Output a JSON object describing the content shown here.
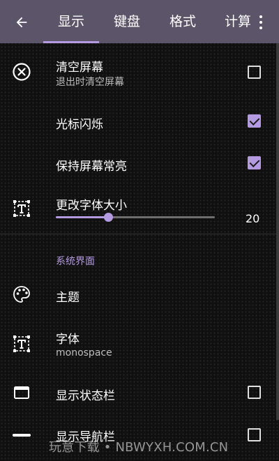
{
  "appbar": {
    "tabs": [
      "显示",
      "键盘",
      "格式",
      "计算"
    ],
    "active_tab": 0,
    "accent_color": "#b49ae0"
  },
  "settings": {
    "clear_screen": {
      "title": "清空屏幕",
      "subtitle": "退出时清空屏幕",
      "checked": false,
      "icon": "clear-circle-icon"
    },
    "cursor_blink": {
      "title": "光标闪烁",
      "checked": true
    },
    "keep_screen_on": {
      "title": "保持屏幕常亮",
      "checked": true
    },
    "font_size": {
      "title": "更改字体大小",
      "value": "20",
      "slider_fraction": 0.33,
      "icon": "font-size-icon"
    },
    "section_system_ui": "系统界面",
    "theme": {
      "title": "主题",
      "icon": "palette-icon"
    },
    "font": {
      "title": "字体",
      "subtitle": "monospace",
      "icon": "font-icon"
    },
    "show_status_bar": {
      "title": "显示状态栏",
      "checked": false,
      "icon": "status-bar-icon"
    },
    "show_nav_bar": {
      "title": "显示导航栏",
      "checked": false,
      "icon": "nav-bar-icon"
    }
  },
  "watermark": "玩意下载 • NBWYXH.COM.CN"
}
